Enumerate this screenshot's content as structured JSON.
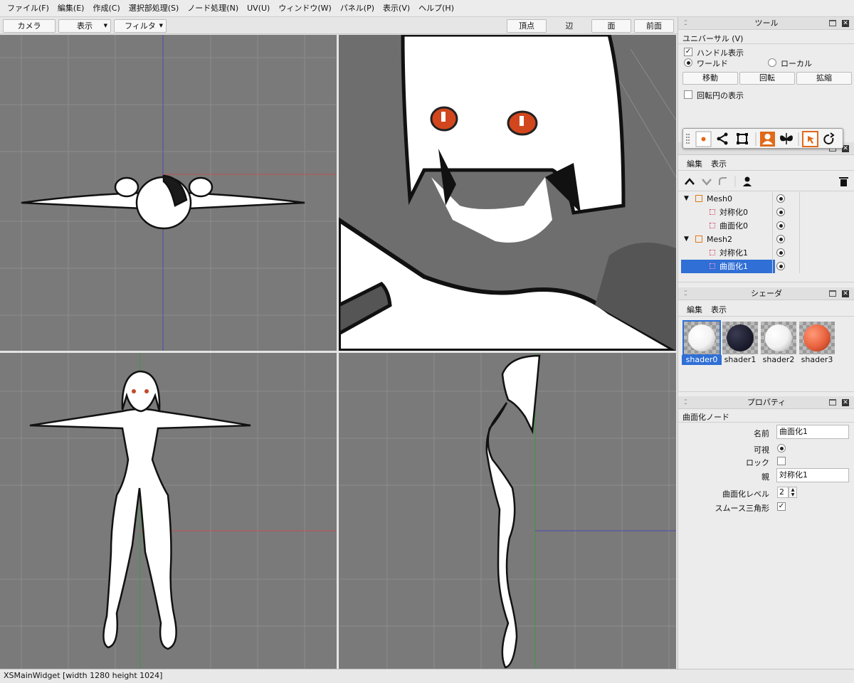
{
  "menu": [
    "ファイル(F)",
    "編集(E)",
    "作成(C)",
    "選択部処理(S)",
    "ノード処理(N)",
    "UV(U)",
    "ウィンドウ(W)",
    "パネル(P)",
    "表示(V)",
    "ヘルプ(H)"
  ],
  "toolbar": {
    "camera": "カメラ",
    "display": "表示",
    "filter": "フィルタ",
    "vertex": "頂点",
    "edge": "辺",
    "face": "面",
    "front": "前面"
  },
  "tool_panel": {
    "title": "ツール",
    "mode": "ユニバーサル (V)",
    "handle_label": "ハンドル表示",
    "handle_checked": true,
    "world": "ワールド",
    "local": "ローカル",
    "coord_selected": "world",
    "move": "移動",
    "rotate": "回転",
    "scale": "拡縮",
    "rotate_circle": "回転円の表示",
    "rotate_circle_checked": false
  },
  "node_panel": {
    "menu_edit": "編集",
    "menu_view": "表示",
    "nodes": [
      {
        "label": "Mesh0",
        "type": "mesh",
        "expanded": true,
        "selected": false
      },
      {
        "label": "対称化0",
        "type": "modifier",
        "selected": false
      },
      {
        "label": "曲面化0",
        "type": "modifier",
        "selected": false
      },
      {
        "label": "Mesh2",
        "type": "mesh",
        "expanded": true,
        "selected": false
      },
      {
        "label": "対称化1",
        "type": "modifier",
        "selected": false
      },
      {
        "label": "曲面化1",
        "type": "modifier",
        "selected": true
      }
    ]
  },
  "shader_panel": {
    "title": "シェーダ",
    "menu_edit": "編集",
    "menu_view": "表示",
    "shaders": [
      {
        "name": "shader0",
        "color": "#ffffff",
        "selected": true
      },
      {
        "name": "shader1",
        "color": "#1c1c2e",
        "selected": false
      },
      {
        "name": "shader2",
        "color": "#ffffff",
        "selected": false
      },
      {
        "name": "shader3",
        "color": "#e8603c",
        "selected": false
      }
    ]
  },
  "property_panel": {
    "title": "プロパティ",
    "section": "曲面化ノード",
    "name_label": "名前",
    "name_value": "曲面化1",
    "visible_label": "可視",
    "visible": true,
    "lock_label": "ロック",
    "lock": false,
    "parent_label": "親",
    "parent_value": "対称化1",
    "level_label": "曲面化レベル",
    "level_value": "2",
    "smooth_label": "スムース三角形",
    "smooth": true
  },
  "status": "XSMainWidget [width 1280 height 1024]",
  "colors": {
    "accent": "#2f6fd6",
    "viewport_bg": "#7a7a7a",
    "grid": "#8a8a8a",
    "tool_orange": "#e06a1a"
  }
}
